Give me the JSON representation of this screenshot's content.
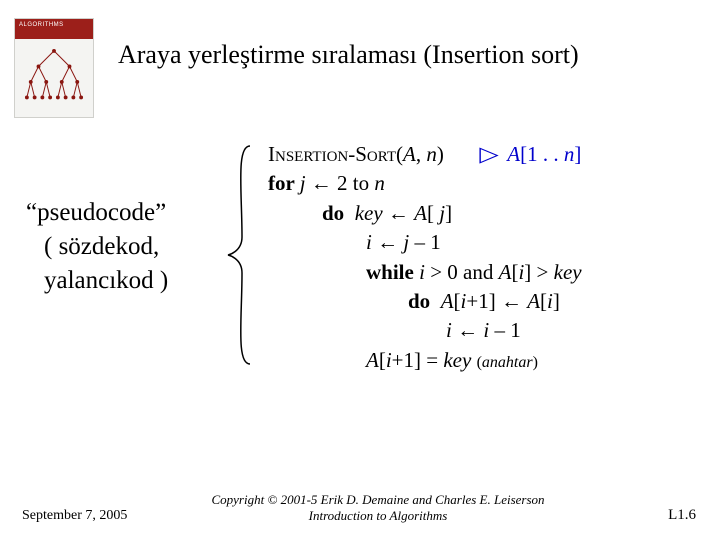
{
  "cover": {
    "label": "ALGORITHMS"
  },
  "title": "Araya yerleştirme sıralaması (Insertion sort)",
  "left": {
    "line1": "“pseudocode”",
    "line2": "( sözdekod,",
    "line3": "yalancıkod )"
  },
  "algo": {
    "name": "Insertion-Sort",
    "args_open": "(",
    "A": "A",
    "comma_n": ", ",
    "n": "n",
    "args_close": ")",
    "tri": "▷",
    "annot_A": "A",
    "annot_bracket": "[1 . . ",
    "annot_n": "n",
    "annot_close": "]",
    "for": "for ",
    "j": "j",
    "arrow": " ← ",
    "two_to": "2 to ",
    "do": "do",
    "key": "key",
    "Aj_open": "A",
    "bracket_j": "[ ",
    "bracket_j_close": "]",
    "i": "i",
    "jm1": " – 1",
    "while": "while ",
    "gt0_and": " > 0 and ",
    "Ai": "A",
    "bracket_i_open": "[",
    "bracket_i_close": "]",
    "gt": " > ",
    "Aip1": "A",
    "ip1": "+1",
    "eq": " = ",
    "anahtar_open": "(",
    "anahtar": "anahtar",
    "anahtar_close": ")"
  },
  "footer": {
    "date": "September 7, 2005",
    "copy1": "Copyright © 2001-5 Erik D. Demaine and Charles E. Leiserson",
    "copy2": "Introduction to Algorithms",
    "page": "L1.6"
  }
}
